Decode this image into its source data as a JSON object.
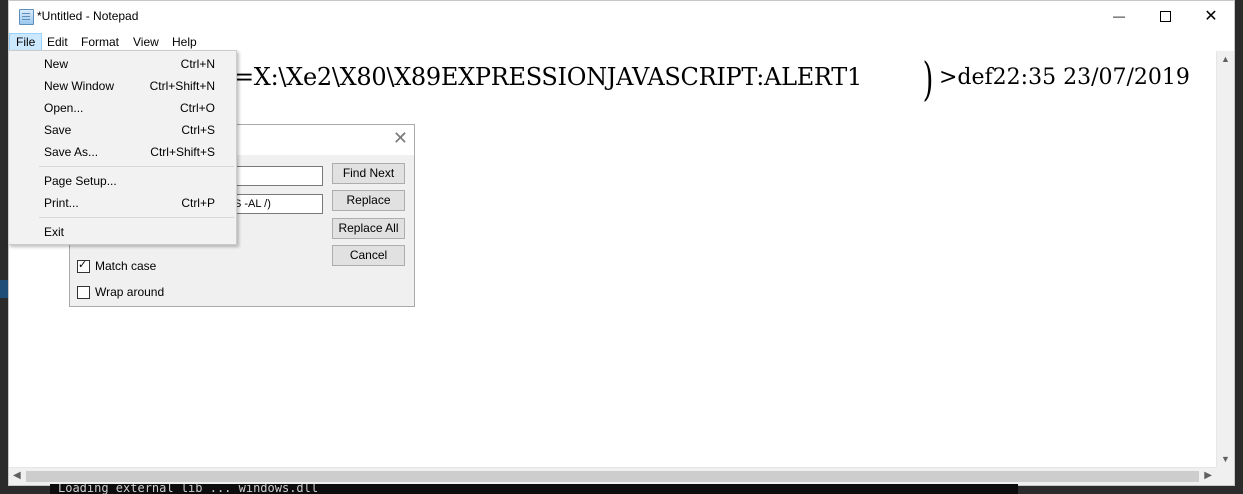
{
  "window": {
    "title": "*Untitled - Notepad",
    "minimize_glyph": "—",
    "close_glyph": "✕"
  },
  "menubar": {
    "items": [
      {
        "label": "File"
      },
      {
        "label": "Edit"
      },
      {
        "label": "Format"
      },
      {
        "label": "View"
      },
      {
        "label": "Help"
      }
    ]
  },
  "editor": {
    "text_visible": "=X:\\Xe2\\X80\\X89EXPRESSIONJAVASCRIPT:ALERT1",
    "paren": ")",
    "text_after": ">def22:35 23/07/2019"
  },
  "file_menu": {
    "items": [
      {
        "label": "New",
        "shortcut": "Ctrl+N"
      },
      {
        "label": "New Window",
        "shortcut": "Ctrl+Shift+N"
      },
      {
        "label": "Open...",
        "shortcut": "Ctrl+O"
      },
      {
        "label": "Save",
        "shortcut": "Ctrl+S"
      },
      {
        "label": "Save As...",
        "shortcut": "Ctrl+Shift+S"
      },
      {
        "label": "Page Setup...",
        "shortcut": ""
      },
      {
        "label": "Print...",
        "shortcut": "Ctrl+P"
      },
      {
        "label": "Exit",
        "shortcut": ""
      }
    ]
  },
  "replace_dialog": {
    "close_glyph": "✕",
    "find_value": "",
    "replace_value": "S -AL /)",
    "buttons": {
      "find_next": "Find Next",
      "replace": "Replace",
      "replace_all": "Replace All",
      "cancel": "Cancel"
    },
    "match_case": {
      "label": "Match case",
      "checked": true
    },
    "wrap_around": {
      "label": "Wrap around",
      "checked": false
    }
  },
  "console": {
    "text": "Loading external lib ... windows.dll"
  },
  "icons": [
    "notepad-icon",
    "minimize-icon",
    "maximize-icon",
    "close-icon",
    "scroll-up-icon",
    "scroll-down-icon",
    "scroll-left-icon",
    "scroll-right-icon",
    "checkmark-icon"
  ]
}
